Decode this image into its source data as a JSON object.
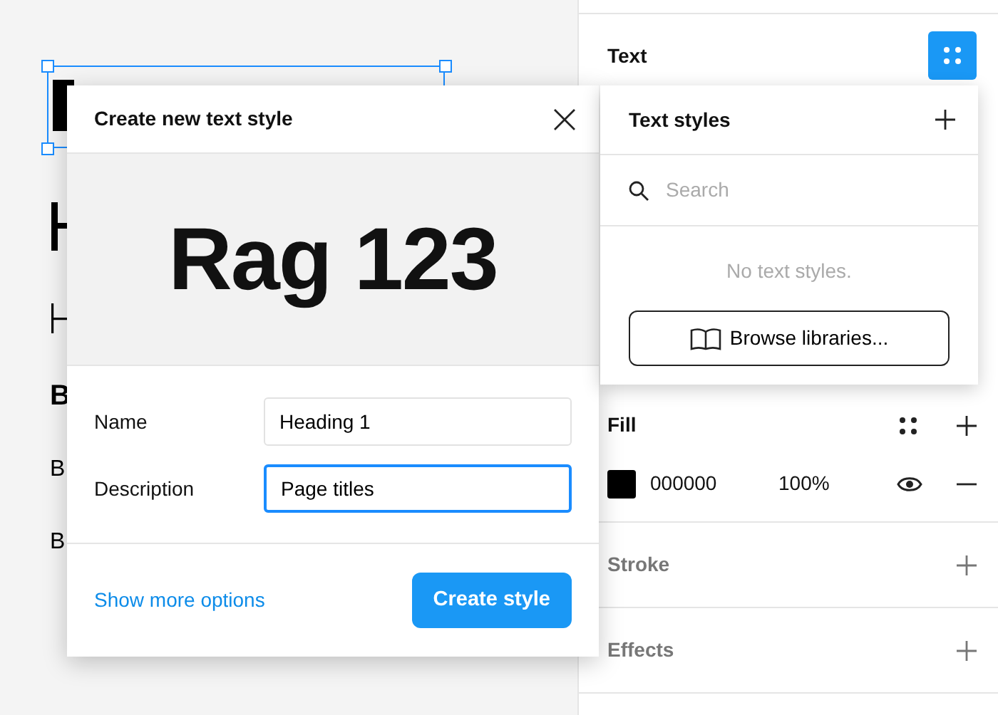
{
  "canvas": {
    "layers": [
      {
        "text": "B",
        "kind": "bold"
      },
      {
        "text": "B",
        "kind": "body"
      },
      {
        "text": "B",
        "kind": "body"
      }
    ]
  },
  "dialog": {
    "title": "Create new text style",
    "preview": "Rag 123",
    "fields": [
      {
        "label": "Name",
        "value": "Heading 1",
        "focused": false
      },
      {
        "label": "Description",
        "value": "Page titles",
        "focused": true
      }
    ],
    "link": "Show more options",
    "button": "Create style"
  },
  "panel": {
    "text_title": "Text",
    "styles_popover": {
      "title": "Text styles",
      "search_placeholder": "Search",
      "empty": "No text styles.",
      "button": "Browse libraries..."
    },
    "fill": {
      "title": "Fill",
      "hex": "000000",
      "opacity": "100%",
      "visible": true
    },
    "sections": [
      {
        "title": "Stroke"
      },
      {
        "title": "Effects"
      }
    ]
  }
}
